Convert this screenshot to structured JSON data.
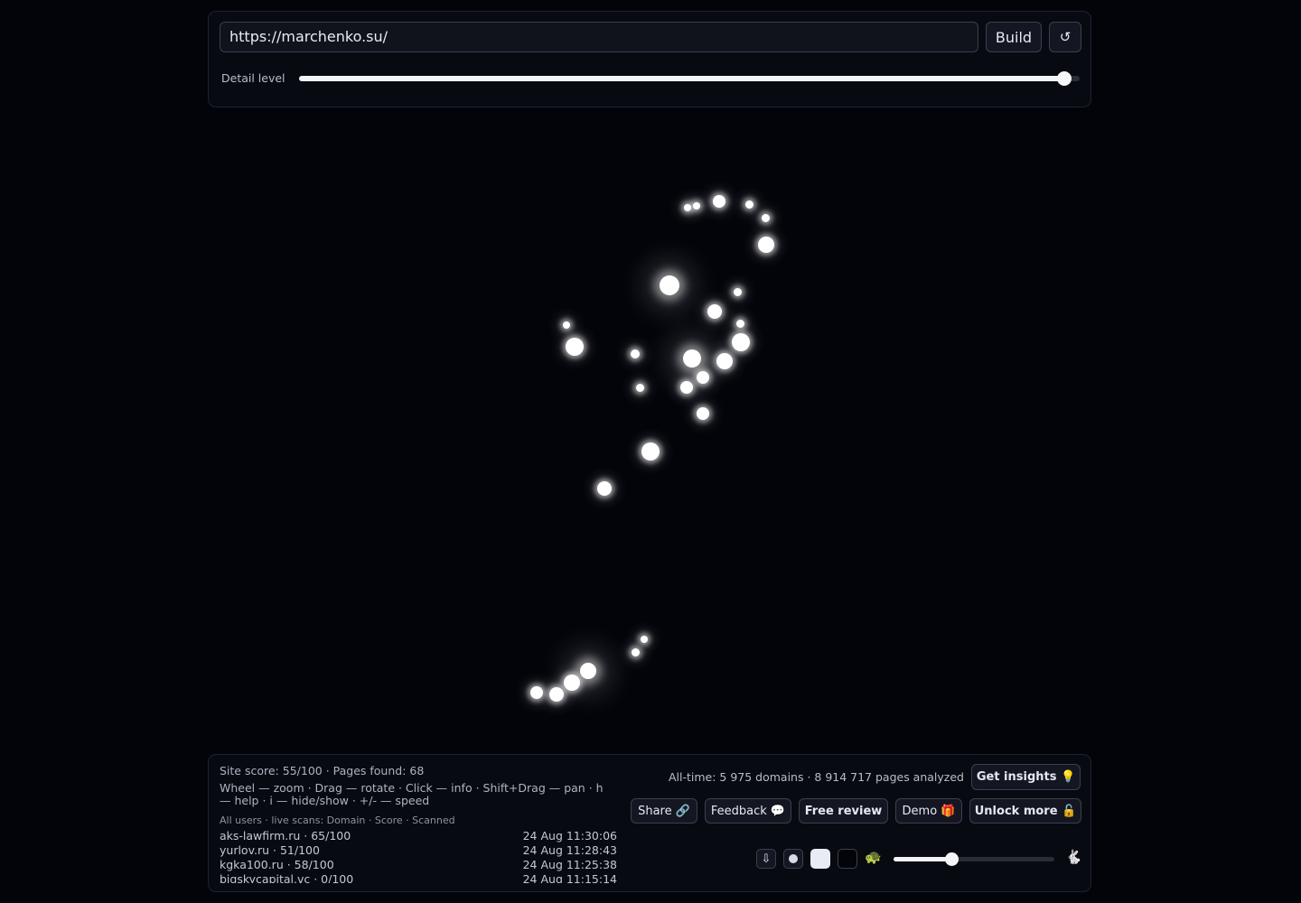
{
  "top": {
    "url_value": "https://marchenko.su/",
    "build_label": "Build",
    "reload_icon": "↺",
    "detail_label": "Detail level",
    "detail_level_fraction": 0.98
  },
  "graph": {
    "node_color": "#ffffff",
    "background": "#03040a",
    "node_count": 32
  },
  "bottom": {
    "site_stats": "Site score: 55/100 · Pages found: 68",
    "help_text": "Wheel — zoom · Drag — rotate · Click — info · Shift+Drag — pan · h — help · i — hide/show · +/- — speed",
    "live_header": "All users · live scans: Domain · Score · Scanned",
    "scans": [
      {
        "domain": "aks-lawfirm.ru · 65/100",
        "time": "24 Aug 11:30:06"
      },
      {
        "domain": "yurlov.ru · 51/100",
        "time": "24 Aug 11:28:43"
      },
      {
        "domain": "kgka100.ru · 58/100",
        "time": "24 Aug 11:25:38"
      },
      {
        "domain": "bigskycapital.vc · 0/100",
        "time": "24 Aug 11:15:14"
      }
    ],
    "alltime": "All-time: 5 975 domains · 8 914 717 pages analyzed",
    "insights_label": "Get insights 💡",
    "share_label": "Share 🔗",
    "feedback_label": "Feedback 💬",
    "review_label": "Free review",
    "demo_label": "Demo 🎁",
    "unlock_label": "Unlock more 🔓",
    "download_icon": "⇩",
    "turtle_icon": "🐢",
    "rabbit_icon": "🐇",
    "speed_fraction": 0.36
  }
}
